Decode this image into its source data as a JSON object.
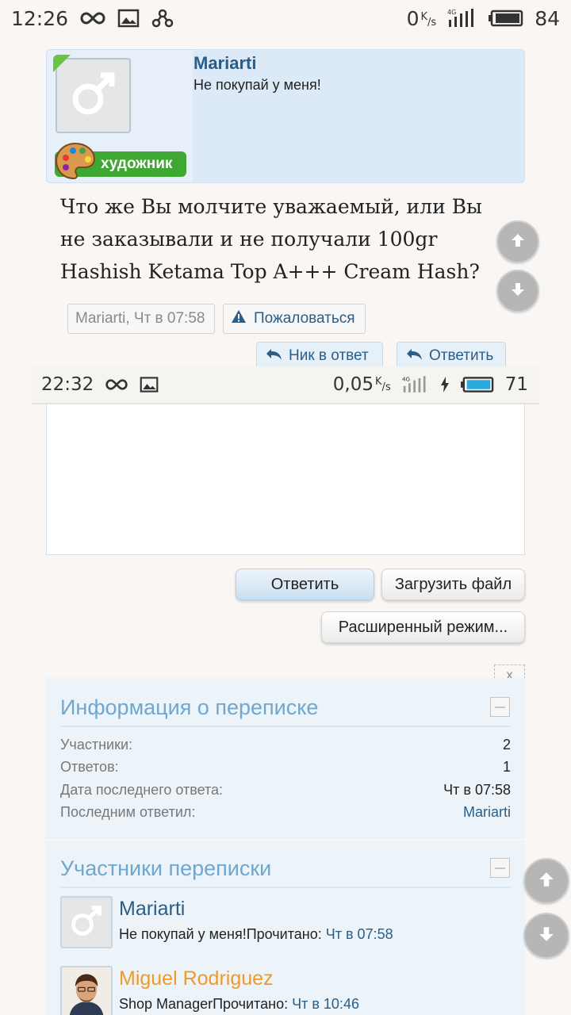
{
  "status_bar_top": {
    "time": "12:26",
    "net_speed": "0",
    "net_unit_k": "K",
    "net_unit_s": "s",
    "network": "4G",
    "battery": "84"
  },
  "post": {
    "username": "Mariarti",
    "user_status": "Не покупай у меня!",
    "role_badge": "художник",
    "message": "Что же Вы молчите уважаемый, или Вы не заказывали и не получали 100gr Hashish Ketama Top A+++ Cream Hash?",
    "meta_user": "Mariarti",
    "meta_time": ", Чт в 07:58",
    "report_label": "Пожаловаться",
    "nick_reply_label": "Ник в ответ",
    "reply_label": "Ответить"
  },
  "status_bar_bottom": {
    "time": "22:32",
    "net_speed": "0,05",
    "net_unit_k": "K",
    "net_unit_s": "s",
    "network": "4G",
    "battery": "71"
  },
  "editor": {
    "reply_button": "Ответить",
    "upload_button": "Загрузить файл",
    "advanced_button": "Расширенный режим..."
  },
  "close_label": "x",
  "conversation_info": {
    "title": "Информация о переписке",
    "rows": [
      {
        "label": "Участники:",
        "value": "2"
      },
      {
        "label": "Ответов:",
        "value": "1"
      },
      {
        "label": "Дата последнего ответа:",
        "value": "Чт в 07:58"
      },
      {
        "label": "Последним ответил:",
        "value": "Mariarti"
      }
    ]
  },
  "participants": {
    "title": "Участники переписки",
    "members": [
      {
        "name": "Mariarti",
        "title": "Не покупай у меня!",
        "read_label": "Прочитано: ",
        "read_time": "Чт в 07:58"
      },
      {
        "name": "Miguel Rodriguez",
        "title": "Shop Manager",
        "read_label": "Прочитано: ",
        "read_time": "Чт в 10:46"
      }
    ]
  },
  "icons": [
    "infinity-icon",
    "image-icon",
    "link-icon",
    "signal-icon",
    "battery-icon",
    "charging-icon",
    "warning-icon",
    "reply-arrow-icon",
    "arrow-up-icon",
    "arrow-down-icon",
    "male-avatar-icon",
    "palette-icon"
  ],
  "colors": {
    "link": "#2b5d86",
    "panel_title": "#6fa7cf",
    "badge_green": "#3ea832",
    "orange_name": "#ee9a2a",
    "panel_bg": "#edf4f9"
  }
}
